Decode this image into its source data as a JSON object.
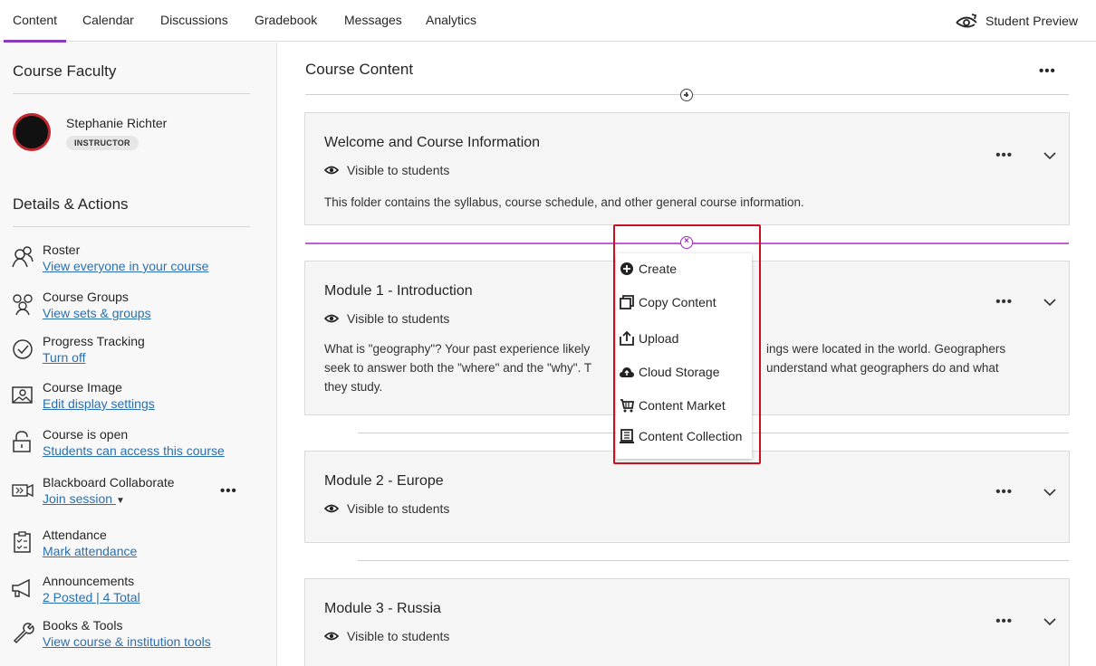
{
  "nav": {
    "tabs": [
      "Content",
      "Calendar",
      "Discussions",
      "Gradebook",
      "Messages",
      "Analytics"
    ],
    "active_tab": "Content",
    "student_preview": "Student Preview"
  },
  "sidebar": {
    "faculty_heading": "Course Faculty",
    "instructor": {
      "name": "Stephanie Richter",
      "role": "INSTRUCTOR"
    },
    "details_heading": "Details & Actions",
    "items": [
      {
        "title": "Roster",
        "link": "View everyone in your course",
        "icon": "roster-icon"
      },
      {
        "title": "Course Groups",
        "link": "View sets & groups",
        "icon": "groups-icon"
      },
      {
        "title": "Progress Tracking",
        "link": "Turn off",
        "icon": "progress-check-icon"
      },
      {
        "title": "Course Image",
        "link": "Edit display settings",
        "icon": "image-icon"
      },
      {
        "title": "Course is open",
        "link": "Students can access this course",
        "icon": "unlock-icon"
      },
      {
        "title": "Blackboard Collaborate",
        "link": "Join session",
        "icon": "collaborate-icon"
      },
      {
        "title": "Attendance",
        "link": "Mark attendance",
        "icon": "attendance-icon"
      },
      {
        "title": "Announcements",
        "link": "2 Posted | 4 Total",
        "icon": "megaphone-icon"
      },
      {
        "title": "Books & Tools",
        "link": "View course & institution tools",
        "icon": "wrench-icon"
      }
    ]
  },
  "main": {
    "title": "Course Content",
    "cards": [
      {
        "title": "Welcome and Course Information",
        "visibility": "Visible to students",
        "description": "This folder contains the syllabus, course schedule, and other general course information."
      },
      {
        "title": "Module 1 - Introduction",
        "visibility": "Visible to students",
        "description_line1": "What is \"geography\"? Your past experience likely",
        "description_line1b": "ings were located in the world. Geographers",
        "description_line2": "seek to answer both the \"where\" and the \"why\". T",
        "description_line2b": "understand what geographers do and what",
        "description_line3": "they study."
      },
      {
        "title": "Module 2 - Europe",
        "visibility": "Visible to students"
      },
      {
        "title": "Module 3 - Russia",
        "visibility": "Visible to students"
      }
    ]
  },
  "add_menu": {
    "items": [
      {
        "label": "Create",
        "icon": "plus-circle-icon"
      },
      {
        "label": "Copy Content",
        "icon": "copy-icon"
      },
      {
        "label": "Upload",
        "icon": "upload-icon"
      },
      {
        "label": "Cloud Storage",
        "icon": "cloud-icon"
      },
      {
        "label": "Content Market",
        "icon": "cart-icon"
      },
      {
        "label": "Content Collection",
        "icon": "collection-icon"
      }
    ]
  },
  "colors": {
    "accent": "#8c3bb8",
    "link": "#2a6fb0",
    "highlight": "#c8101e",
    "insert_line": "#c25ed6"
  }
}
